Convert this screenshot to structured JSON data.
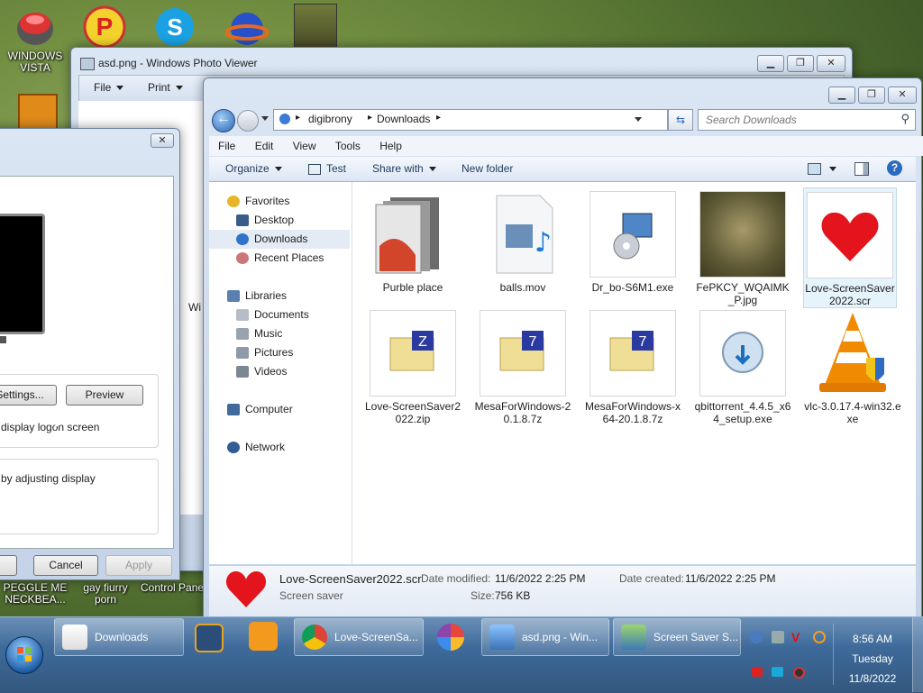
{
  "desktop": {
    "icons": [
      {
        "label": "WINDOWS VISTA"
      },
      {
        "label": "PEGGLE ME NECKBEA..."
      },
      {
        "label": "gay fiurry porn"
      },
      {
        "label": "Control Panel"
      }
    ]
  },
  "photo_viewer": {
    "title": "asd.png - Windows Photo Viewer",
    "menu": [
      "File",
      "Print"
    ],
    "partial_text": "Wi"
  },
  "screensaver_dialog": {
    "settings_label": "Settings...",
    "preview_label": "Preview",
    "logon_text": "display logon screen",
    "power_text": "by adjusting display",
    "ok_label": "",
    "cancel_label": "Cancel",
    "apply_label": "Apply"
  },
  "explorer": {
    "breadcrumb": [
      "digibrony",
      "Downloads"
    ],
    "search_placeholder": "Search Downloads",
    "menu": [
      "File",
      "Edit",
      "View",
      "Tools",
      "Help"
    ],
    "toolbar": {
      "organize": "Organize",
      "test": "Test",
      "share_with": "Share with",
      "new_folder": "New folder"
    },
    "nav": {
      "favorites": "Favorites",
      "desktop": "Desktop",
      "downloads": "Downloads",
      "recent": "Recent Places",
      "libraries": "Libraries",
      "documents": "Documents",
      "music": "Music",
      "pictures": "Pictures",
      "videos": "Videos",
      "computer": "Computer",
      "network": "Network"
    },
    "files": [
      {
        "name": "Purble place"
      },
      {
        "name": "balls.mov"
      },
      {
        "name": "Dr_bo-S6M1.exe"
      },
      {
        "name": "FePKCY_WQAIMK_P.jpg"
      },
      {
        "name": "Love-ScreenSaver2022.scr"
      },
      {
        "name": "Love-ScreenSaver2022.zip"
      },
      {
        "name": "MesaForWindows-20.1.8.7z"
      },
      {
        "name": "MesaForWindows-x64-20.1.8.7z"
      },
      {
        "name": "qbittorrent_4.4.5_x64_setup.exe"
      },
      {
        "name": "vlc-3.0.17.4-win32.exe"
      }
    ],
    "details": {
      "name": "Love-ScreenSaver2022.scr",
      "type": "Screen saver",
      "modified_label": "Date modified:",
      "modified_value": "11/6/2022 2:25 PM",
      "created_label": "Date created:",
      "created_value": "11/6/2022 2:25 PM",
      "size_label": "Size:",
      "size_value": "756 KB"
    }
  },
  "taskbar": {
    "items": [
      {
        "label": "Downloads"
      },
      {
        "label": "Love-ScreenSa..."
      },
      {
        "label": "asd.png - Win..."
      },
      {
        "label": "Screen Saver S..."
      }
    ],
    "clock": {
      "time": "8:56 AM",
      "day": "Tuesday",
      "date": "11/8/2022"
    }
  },
  "colors": {
    "taskbar": "#3e6a9a",
    "selection": "#cce8ff",
    "accent": "#1e395b"
  }
}
